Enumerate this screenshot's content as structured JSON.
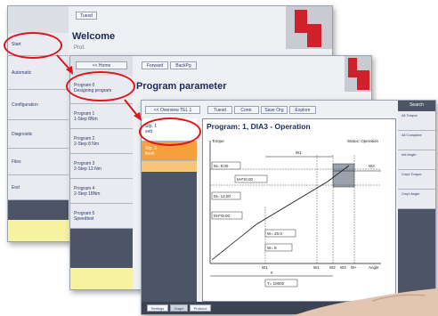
{
  "window1": {
    "tab": "Tuesd",
    "title": "Welcome",
    "subtitle": "Prof.",
    "sidebar": [
      "Start",
      "Automatic",
      "Configuration",
      "Diagnostic",
      "Files",
      "End"
    ]
  },
  "window2": {
    "tabs": [
      "Forward",
      "BackPg"
    ],
    "back_button": "<< Home",
    "title": "Program parameter",
    "programs": [
      {
        "line1": "Program 0",
        "line2": "Designing program"
      },
      {
        "line1": "Program 1",
        "line2": "1-Step 8Nm"
      },
      {
        "line1": "Program 2",
        "line2": "2-Step 8 Nm"
      },
      {
        "line1": "Program 3",
        "line2": "2-Step 12 Nm"
      },
      {
        "line1": "Program 4",
        "line2": "2-Step 18Nm"
      },
      {
        "line1": "Program 5",
        "line2": "Speedtest"
      }
    ]
  },
  "window3": {
    "back_button": "<< Overview TEL 1",
    "tabs": [
      "Tuesd",
      "Contr.",
      "Save Org",
      "Explore"
    ],
    "steps": [
      {
        "line1": "Stp. 1",
        "line2": "sett"
      },
      {
        "line1": "Stp. 2",
        "line2": "finsh"
      }
    ],
    "title": "Program: 1, DIA3 - Operation",
    "status_tabs": [
      "Settings",
      "Graph",
      "Protocol"
    ],
    "right_panel": {
      "header": "Search",
      "items": [
        "All Torque",
        "All Complete",
        "Intl Angle",
        "Cmpl Torque",
        "Cmpl Angle"
      ]
    }
  },
  "chart_data": {
    "type": "line",
    "title": "",
    "ylabel": "Torque",
    "xlabel": "Angle",
    "corner_note": "Status: Operation",
    "fields": [
      "M= 8.00",
      "M-F/0.00",
      "M= 12.00",
      "M-F/0.00",
      "W= 20.0",
      "W= 8",
      "T= 10000"
    ],
    "axis_markers": [
      "W1",
      "W1",
      "W2",
      "W3",
      "W+"
    ],
    "top_markers": [
      "W1",
      "W2"
    ],
    "footer_marker": "#"
  },
  "colors": {
    "accent_red": "#d0202a",
    "highlight_orange": "#f5a03c",
    "sidebar_dark": "#4b5566",
    "note_yellow": "#f7f2a0",
    "title_blue": "#1a2a5a"
  }
}
